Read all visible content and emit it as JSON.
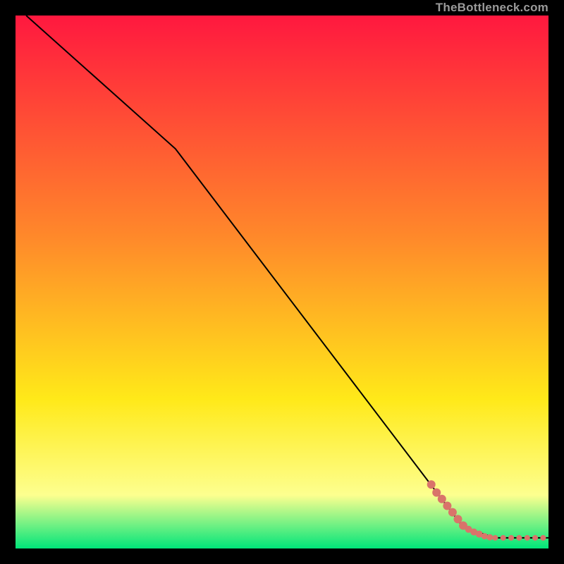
{
  "watermark": "TheBottleneck.com",
  "colors": {
    "line": "#000000",
    "marker": "#d9746a",
    "grad_top": "#ff183f",
    "grad_mid1": "#ff8a2a",
    "grad_mid2": "#ffe919",
    "grad_mid3": "#fdff8f",
    "grad_bot": "#00e57a"
  },
  "chart_data": {
    "type": "line",
    "title": "",
    "xlabel": "",
    "ylabel": "",
    "xlim": [
      0,
      100
    ],
    "ylim": [
      0,
      100
    ],
    "line_points": [
      {
        "x": 2,
        "y": 100
      },
      {
        "x": 30,
        "y": 75
      },
      {
        "x": 84,
        "y": 4
      },
      {
        "x": 90,
        "y": 2
      },
      {
        "x": 100,
        "y": 2
      }
    ],
    "markers": [
      {
        "x": 78,
        "y": 12,
        "r": 6
      },
      {
        "x": 79,
        "y": 10.5,
        "r": 6
      },
      {
        "x": 80,
        "y": 9.3,
        "r": 6
      },
      {
        "x": 81,
        "y": 8,
        "r": 6
      },
      {
        "x": 82,
        "y": 6.8,
        "r": 6
      },
      {
        "x": 83,
        "y": 5.5,
        "r": 6
      },
      {
        "x": 84,
        "y": 4.3,
        "r": 6
      },
      {
        "x": 85,
        "y": 3.6,
        "r": 5
      },
      {
        "x": 86,
        "y": 3.1,
        "r": 5
      },
      {
        "x": 87,
        "y": 2.7,
        "r": 5
      },
      {
        "x": 88,
        "y": 2.3,
        "r": 4.5
      },
      {
        "x": 89,
        "y": 2.1,
        "r": 4.5
      },
      {
        "x": 90,
        "y": 2.0,
        "r": 4
      },
      {
        "x": 91.5,
        "y": 2.0,
        "r": 4
      },
      {
        "x": 93,
        "y": 2.0,
        "r": 4
      },
      {
        "x": 94.5,
        "y": 2.0,
        "r": 4
      },
      {
        "x": 96,
        "y": 2.0,
        "r": 4
      },
      {
        "x": 97.5,
        "y": 2.0,
        "r": 4
      },
      {
        "x": 99,
        "y": 2.0,
        "r": 4
      }
    ]
  }
}
